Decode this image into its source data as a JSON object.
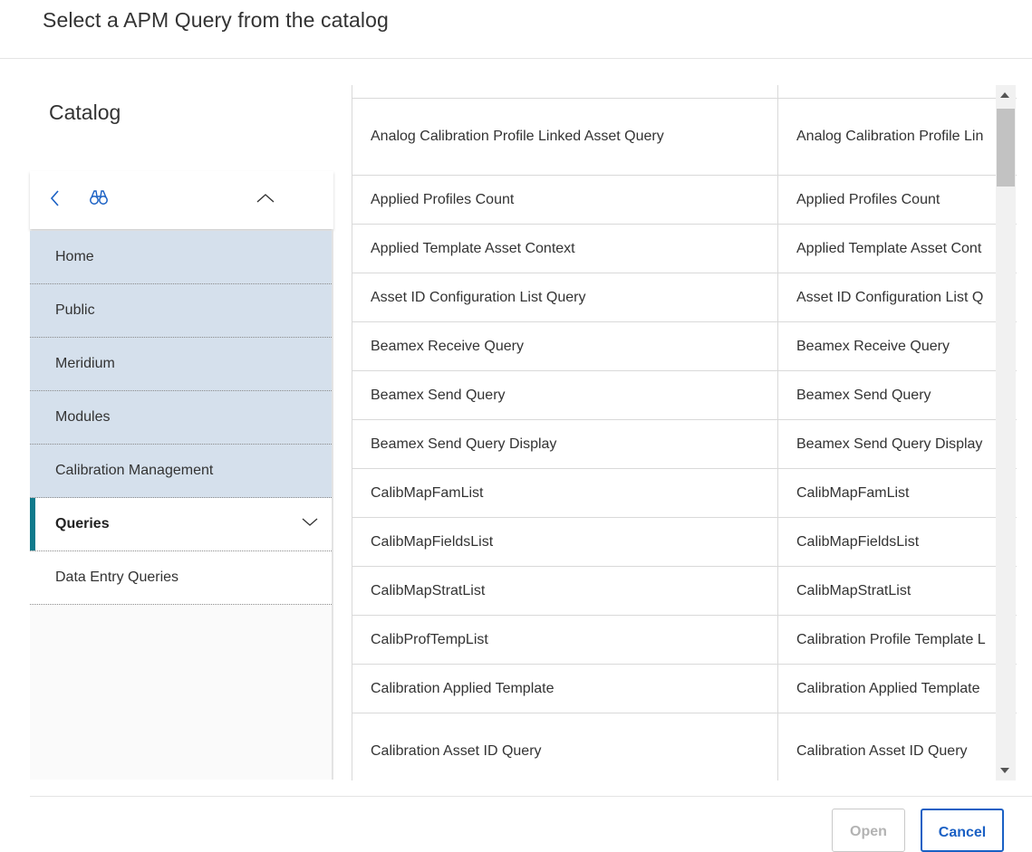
{
  "dialog": {
    "title": "Select a APM Query from the catalog"
  },
  "catalog": {
    "heading": "Catalog",
    "toolbar": {
      "back_icon": "chevron-left-icon",
      "search_icon": "binoculars-icon",
      "collapse_icon": "chevron-up-icon"
    },
    "items": [
      {
        "label": "Home",
        "state": "breadcrumb"
      },
      {
        "label": "Public",
        "state": "breadcrumb"
      },
      {
        "label": "Meridium",
        "state": "breadcrumb"
      },
      {
        "label": "Modules",
        "state": "breadcrumb"
      },
      {
        "label": "Calibration Management",
        "state": "breadcrumb"
      },
      {
        "label": "Queries",
        "state": "selected",
        "icon": "chevron-down-icon"
      },
      {
        "label": "Data Entry Queries",
        "state": "child"
      }
    ]
  },
  "results": {
    "rows": [
      {
        "name": "",
        "caption": ""
      },
      {
        "name": "Analog Calibration Profile Linked Asset Query",
        "caption": "Analog Calibration Profile Lin"
      },
      {
        "name": "Applied Profiles Count",
        "caption": "Applied Profiles Count"
      },
      {
        "name": "Applied Template Asset Context",
        "caption": "Applied Template Asset Cont"
      },
      {
        "name": "Asset ID Configuration List Query",
        "caption": "Asset ID Configuration List Q"
      },
      {
        "name": "Beamex Receive Query",
        "caption": "Beamex Receive Query"
      },
      {
        "name": "Beamex Send Query",
        "caption": "Beamex Send Query"
      },
      {
        "name": "Beamex Send Query Display",
        "caption": "Beamex Send Query Display"
      },
      {
        "name": "CalibMapFamList",
        "caption": "CalibMapFamList"
      },
      {
        "name": "CalibMapFieldsList",
        "caption": "CalibMapFieldsList"
      },
      {
        "name": "CalibMapStratList",
        "caption": "CalibMapStratList"
      },
      {
        "name": "CalibProfTempList",
        "caption": "Calibration Profile Template L"
      },
      {
        "name": "Calibration Applied Template",
        "caption": "Calibration Applied Template"
      },
      {
        "name": "Calibration Asset ID Query",
        "caption": "Calibration Asset ID Query"
      }
    ]
  },
  "footer": {
    "open_label": "Open",
    "cancel_label": "Cancel"
  },
  "colors": {
    "accent": "#1a60c4",
    "breadcrumb_bg": "#d5e0ec",
    "selection_bar": "#0f7a8c",
    "icon": "#1a60c4"
  }
}
